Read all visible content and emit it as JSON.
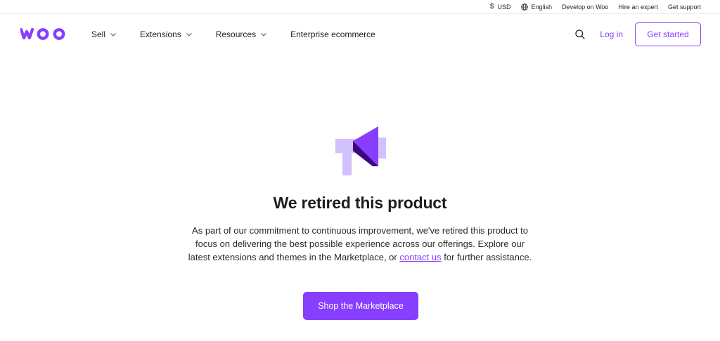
{
  "topbar": {
    "currency": "USD",
    "language": "English",
    "develop": "Develop on Woo",
    "hire": "Hire an expert",
    "support": "Get support"
  },
  "nav": {
    "logo_text": "woo",
    "items": [
      {
        "label": "Sell"
      },
      {
        "label": "Extensions"
      },
      {
        "label": "Resources"
      },
      {
        "label": "Enterprise ecommerce"
      }
    ],
    "login": "Log in",
    "get_started": "Get started"
  },
  "hero": {
    "icon": "megaphone-icon",
    "title": "We retired this product",
    "desc_before": "As part of our commitment to continuous improvement, we've retired this product to focus on delivering the best possible experience across our offerings. Explore our latest extensions and themes in the Marketplace, or ",
    "desc_link": "contact us",
    "desc_after": " for further assistance.",
    "button": "Shop the Marketplace"
  },
  "colors": {
    "brand": "#873eff",
    "brand_light": "#d1c1ff",
    "brand_dark": "#3c087e"
  }
}
